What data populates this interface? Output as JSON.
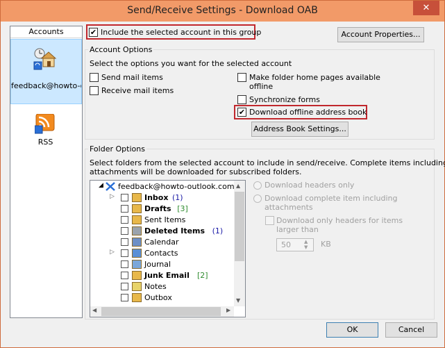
{
  "window": {
    "title": "Send/Receive Settings - Download OAB",
    "close_glyph": "✕"
  },
  "accounts": {
    "header": "Accounts",
    "items": [
      {
        "label": "feedback@howto-outlook.com",
        "icon": "mail-account-icon",
        "selected": true
      },
      {
        "label": "RSS",
        "icon": "rss-icon",
        "selected": false
      }
    ]
  },
  "top": {
    "include_label": "Include the selected account in this group",
    "include_checked": true,
    "account_properties_button": "Account Properties..."
  },
  "account_options": {
    "title": "Account Options",
    "instruction": "Select the options you want for the selected account",
    "send_mail": "Send mail items",
    "receive_mail": "Receive mail items",
    "make_folder_line1": "Make folder home pages available",
    "make_folder_line2": "offline",
    "sync_forms": "Synchronize forms",
    "download_oab": "Download offline address book",
    "download_oab_checked": true,
    "address_book_button": "Address Book Settings..."
  },
  "folder_options": {
    "title": "Folder Options",
    "description_line1": "Select folders from the selected account to include in send/receive. Complete items including",
    "description_line2": "attachments will be downloaded for subscribed folders.",
    "root": "feedback@howto-outlook.com",
    "folders": [
      {
        "name": "Inbox",
        "count": "(1)",
        "bold": true,
        "expander": true,
        "icon": "inbox-icon",
        "count_color": "#1a1aa6"
      },
      {
        "name": "Drafts",
        "count": "[3]",
        "bold": true,
        "expander": false,
        "icon": "drafts-icon",
        "count_color": "#2e8b2e"
      },
      {
        "name": "Sent Items",
        "count": "",
        "bold": false,
        "expander": false,
        "icon": "sent-items-icon",
        "count_color": ""
      },
      {
        "name": "Deleted Items",
        "count": "(1)",
        "bold": true,
        "expander": false,
        "icon": "trash-icon",
        "count_color": "#1a1aa6"
      },
      {
        "name": "Calendar",
        "count": "",
        "bold": false,
        "expander": false,
        "icon": "calendar-icon",
        "count_color": ""
      },
      {
        "name": "Contacts",
        "count": "",
        "bold": false,
        "expander": true,
        "icon": "contacts-icon",
        "count_color": ""
      },
      {
        "name": "Journal",
        "count": "",
        "bold": false,
        "expander": false,
        "icon": "journal-icon",
        "count_color": ""
      },
      {
        "name": "Junk Email",
        "count": "[2]",
        "bold": true,
        "expander": false,
        "icon": "junk-icon",
        "count_color": "#2e8b2e"
      },
      {
        "name": "Notes",
        "count": "",
        "bold": false,
        "expander": false,
        "icon": "notes-icon",
        "count_color": ""
      },
      {
        "name": "Outbox",
        "count": "",
        "bold": false,
        "expander": false,
        "icon": "outbox-icon",
        "count_color": ""
      }
    ],
    "download_headers_only": "Download headers only",
    "download_complete_line1": "Download complete item including",
    "download_complete_line2": "attachments",
    "download_headers_larger_line1": "Download only headers for items",
    "download_headers_larger_line2": "larger than",
    "size_value": "50",
    "size_unit": "KB"
  },
  "footer": {
    "ok": "OK",
    "cancel": "Cancel"
  }
}
